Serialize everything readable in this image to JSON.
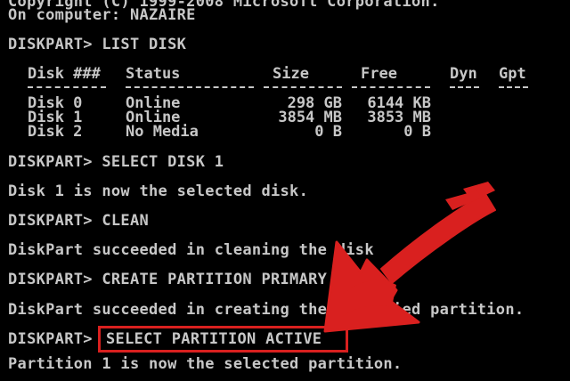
{
  "console": {
    "header_line1": "Copyright (C) 1999-2008 Microsoft Corporation.",
    "header_line2": "On computer: NAZAIRE",
    "cmd_list_disk": "DISKPART> LIST DISK",
    "table": {
      "headers": [
        "Disk ###",
        "Status",
        "Size",
        "Free",
        "Dyn",
        "Gpt"
      ],
      "rows": [
        [
          "Disk 0",
          "Online",
          "298 GB",
          "6144 KB",
          "",
          ""
        ],
        [
          "Disk 1",
          "Online",
          "3854 MB",
          "3853 MB",
          "",
          ""
        ],
        [
          "Disk 2",
          "No Media",
          "0 B",
          "0 B",
          "",
          ""
        ]
      ]
    },
    "cmd_select_disk": "DISKPART> SELECT DISK 1",
    "out_select_disk": "Disk 1 is now the selected disk.",
    "cmd_clean": "DISKPART> CLEAN",
    "out_clean": "DiskPart succeeded in cleaning the disk",
    "cmd_create": "DISKPART> CREATE PARTITION PRIMARY",
    "out_create": "DiskPart succeeded in creating the specified partition.",
    "cmd_select_prompt": "DISKPART>",
    "cmd_select_partition": "SELECT PARTITION ACTIVE",
    "out_select_partition": "Partition 1 is now the selected partition."
  },
  "colors": {
    "background": "#000000",
    "text": "#c7c7c7",
    "annotation": "#d9201f"
  },
  "annotation": {
    "arrow_icon": "red-arrow-icon",
    "box": "red-highlight-box"
  }
}
